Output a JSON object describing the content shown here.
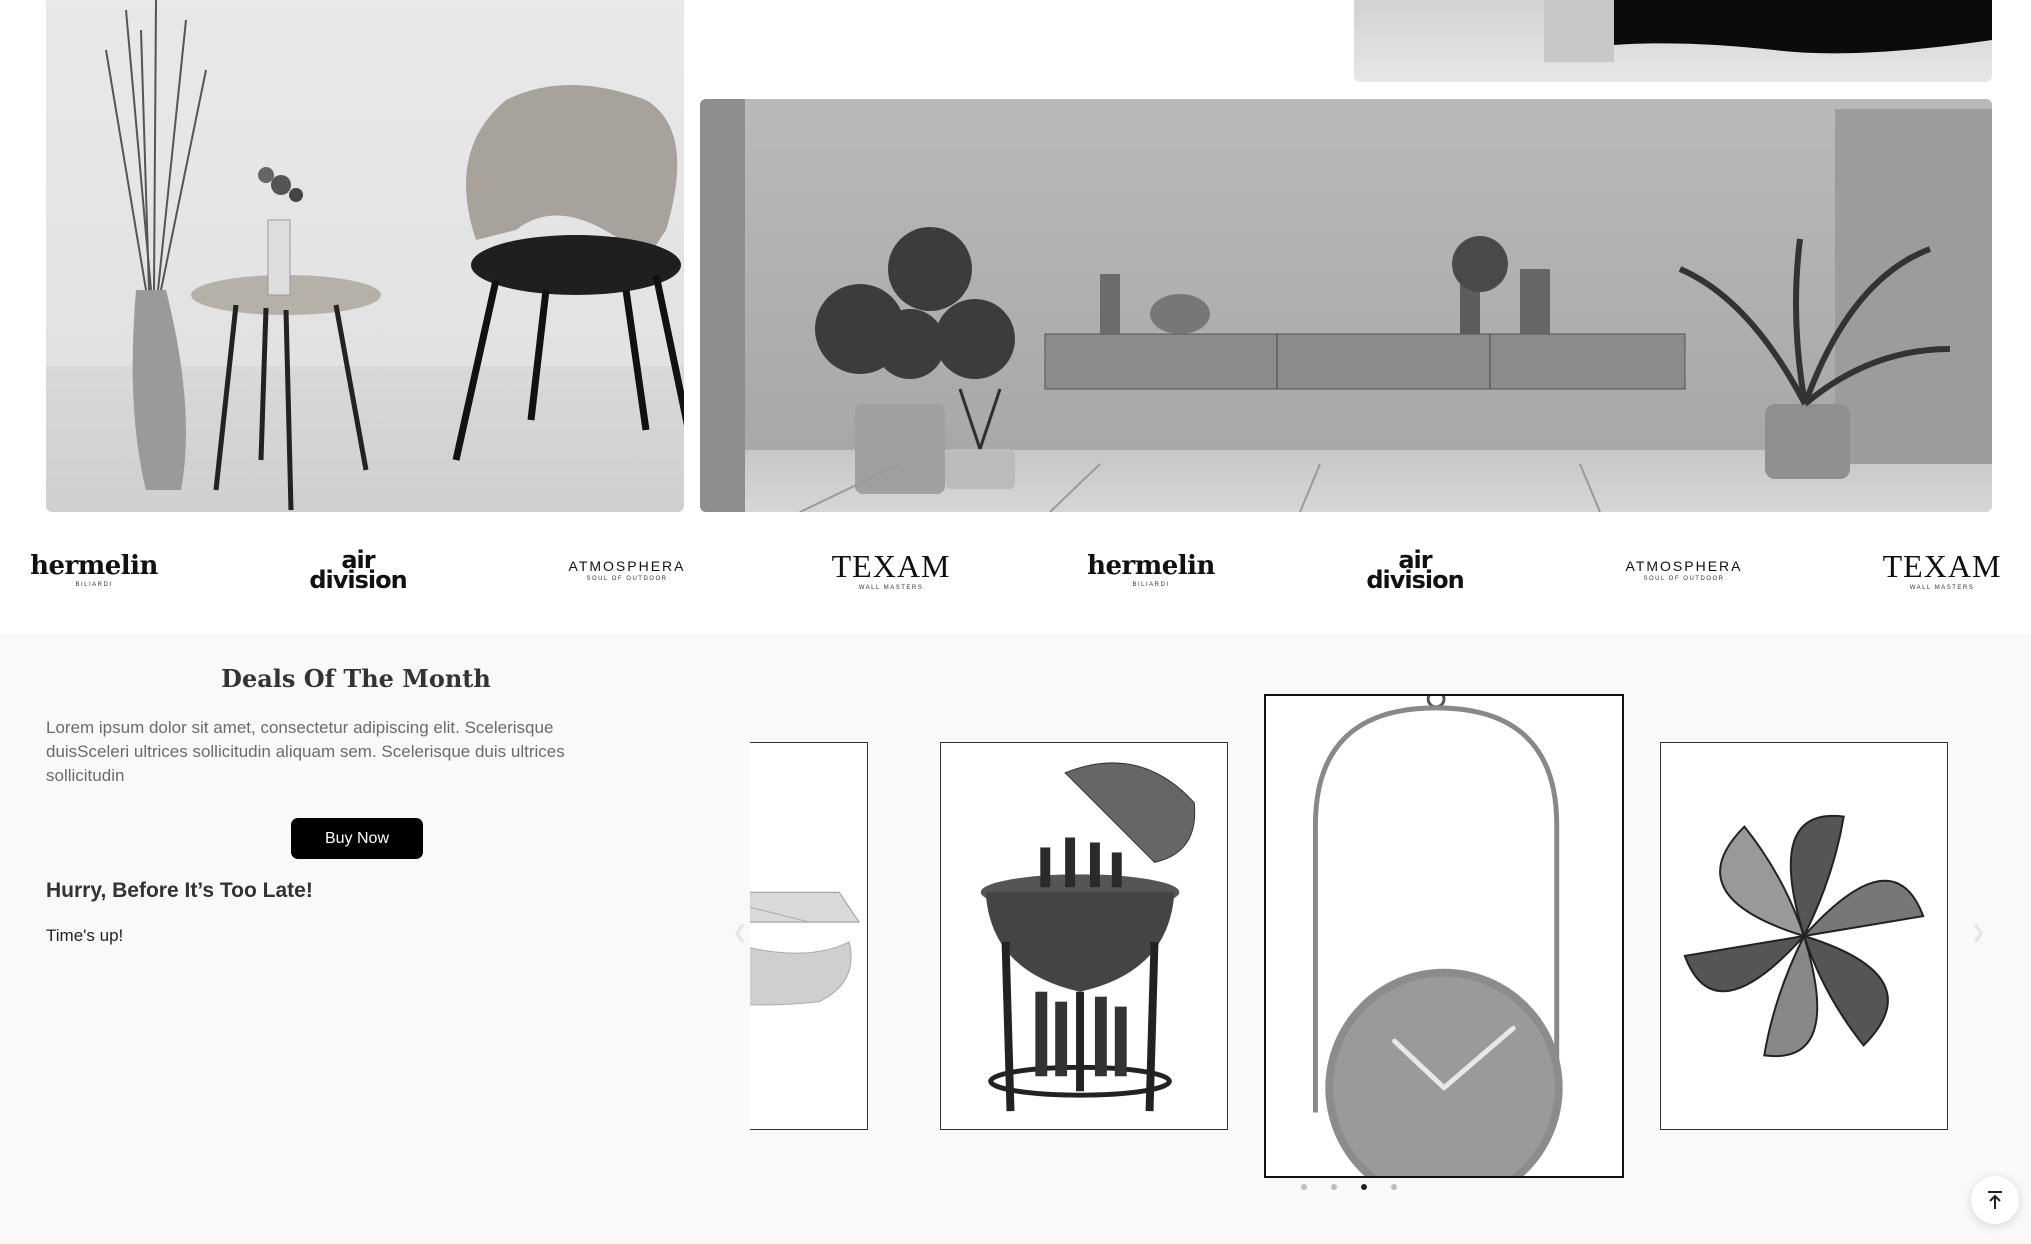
{
  "brands": [
    {
      "name": "hermelin",
      "sub": "BILIARDI"
    },
    {
      "name": "air division",
      "line1": "air",
      "line2": "division"
    },
    {
      "name": "ATMOSPHERA",
      "sub": "SOUL OF OUTDOOR"
    },
    {
      "name": "TEXAM",
      "sub": "WALL MASTERS"
    },
    {
      "name": "hermelin",
      "sub": "BILIARDI"
    },
    {
      "name": "air division",
      "line1": "air",
      "line2": "division"
    },
    {
      "name": "ATMOSPHERA",
      "sub": "SOUL OF OUTDOOR"
    },
    {
      "name": "TEXAM",
      "sub": "WALL MASTERS"
    }
  ],
  "deals": {
    "title": "Deals Of The Month",
    "description": "Lorem ipsum dolor sit amet, consectetur adipiscing elit. Scelerisque duisSceleri ultrices sollicitudin aliquam sem. Scelerisque duis ultrices sollicitudin",
    "button_label": "Buy Now",
    "hurry_text": "Hurry, Before It’s Too Late!",
    "countdown_text": "Time's up!"
  },
  "carousel": {
    "prev_icon": "chevron-left-icon",
    "next_icon": "chevron-right-icon",
    "dots": 4,
    "active_dot": 3
  },
  "icons": {
    "back_to_top": "arrow-up-to-line-icon"
  },
  "colors": {
    "section_bg": "#f9f9f9",
    "button_bg": "#000000",
    "button_text": "#ffffff",
    "desc_text": "#6b6b6b"
  }
}
